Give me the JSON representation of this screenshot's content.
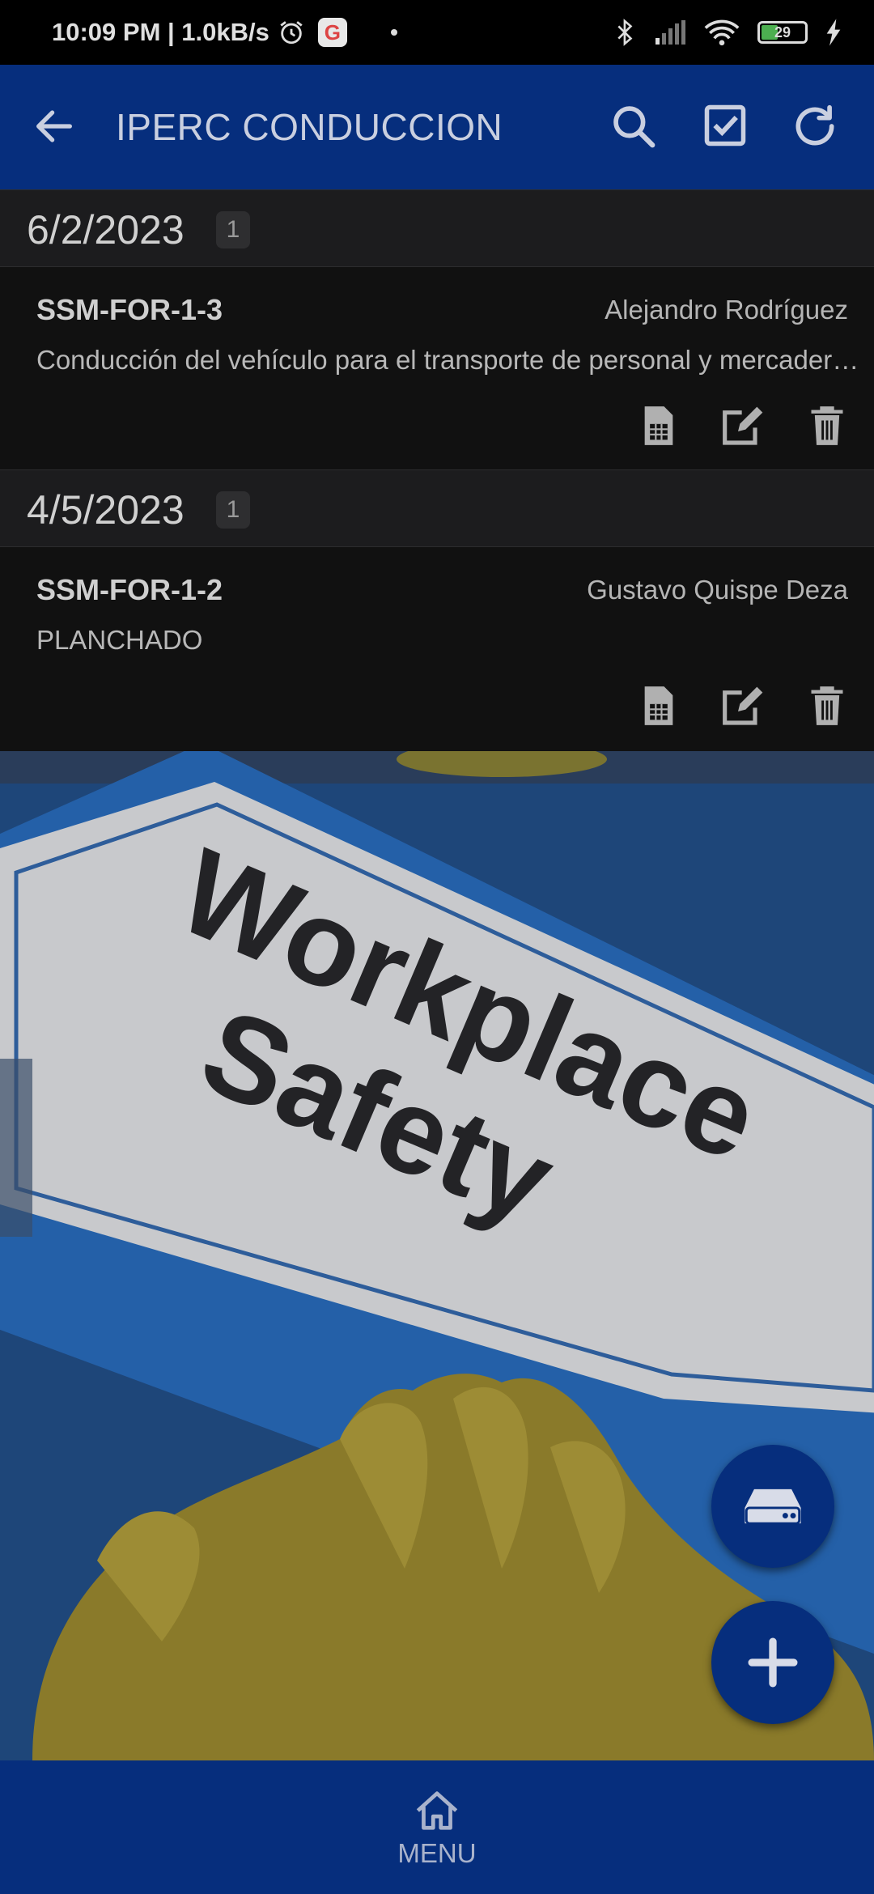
{
  "status_bar": {
    "time_speed": "10:09 PM | 1.0kB/s",
    "google_badge": "G",
    "battery_level": "29"
  },
  "app_bar": {
    "title": "IPERC CONDUCCION"
  },
  "sections": [
    {
      "date": "6/2/2023",
      "count": "1",
      "record": {
        "code": "SSM-FOR-1-3",
        "owner": "Alejandro Rodríguez",
        "description": "Conducción del vehículo para el transporte de personal y mercaderías"
      }
    },
    {
      "date": "4/5/2023",
      "count": "1",
      "record": {
        "code": "SSM-FOR-1-2",
        "owner": "Gustavo Quispe Deza",
        "description": "PLANCHADO"
      }
    }
  ],
  "banner": {
    "line1": "Workplace",
    "line2": "Safety"
  },
  "bottom_nav": {
    "menu_label": "MENU"
  },
  "colors": {
    "primary": "#062e7d",
    "background": "#111111",
    "section_header": "#1c1c1e"
  }
}
